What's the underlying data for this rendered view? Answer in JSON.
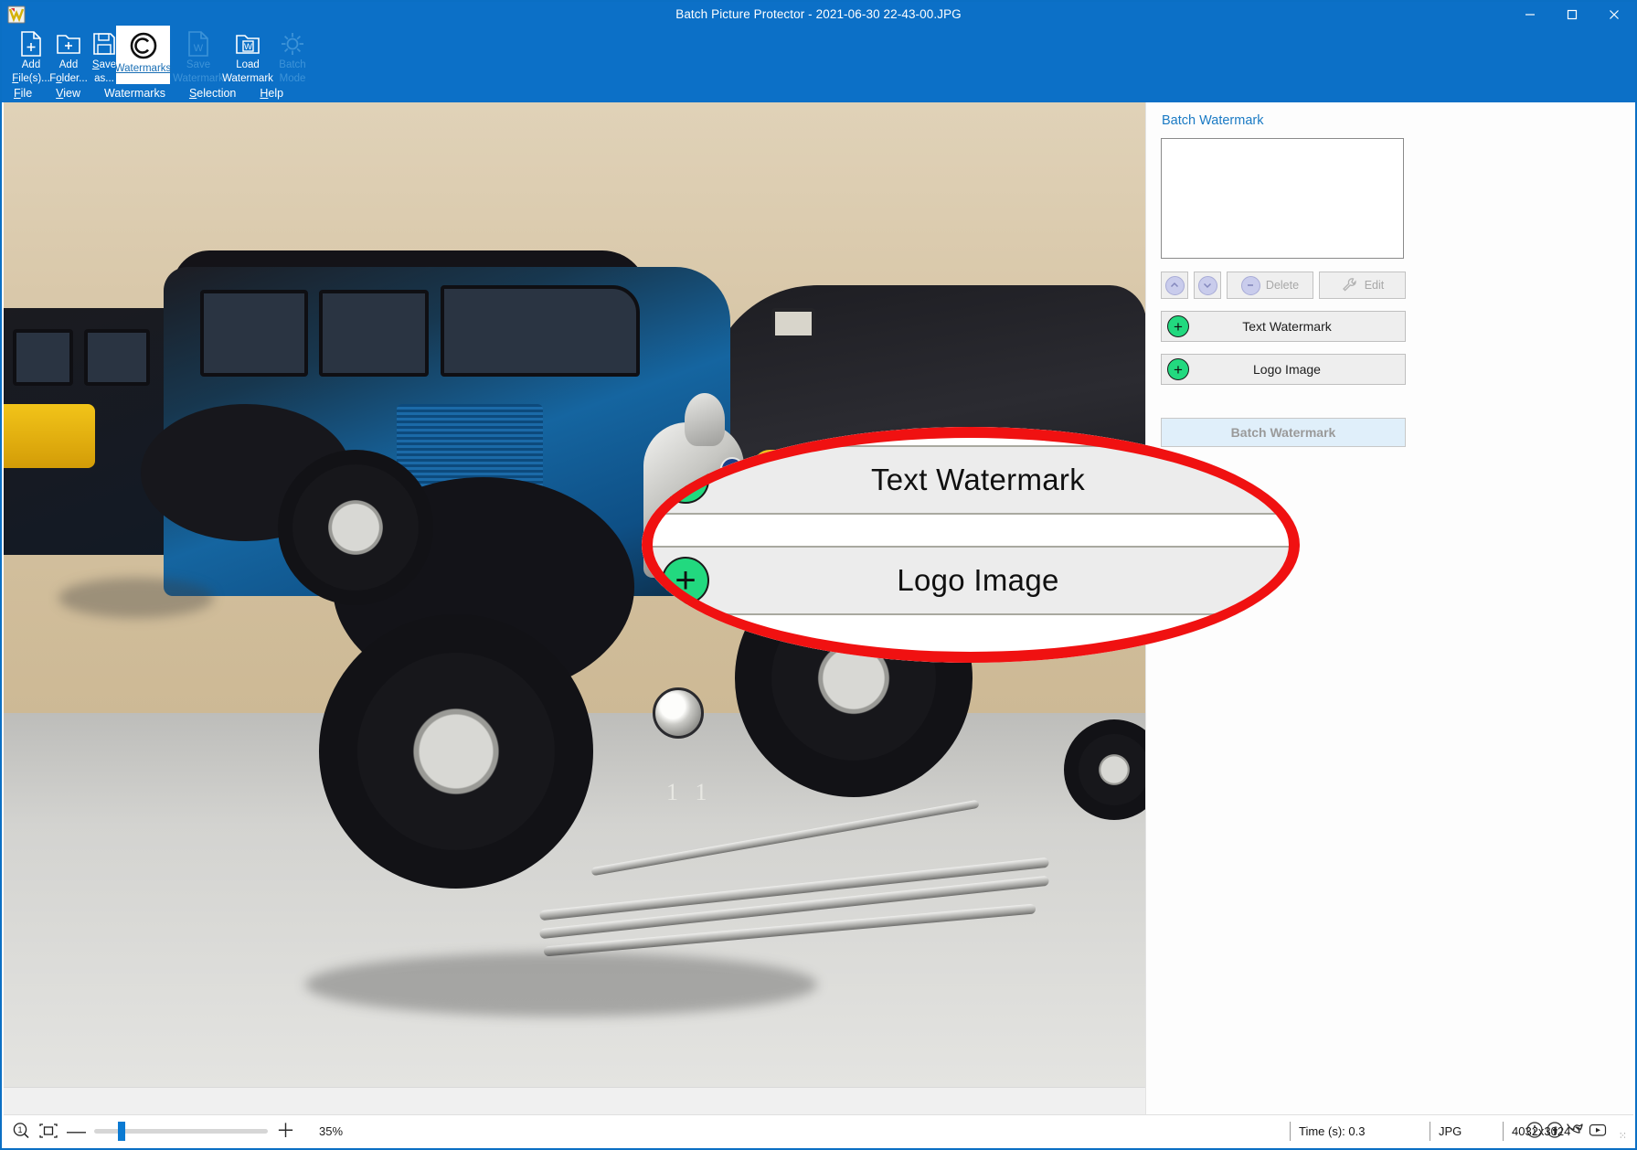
{
  "window": {
    "title": "Batch Picture Protector - 2021-06-30 22-43-00.JPG",
    "app_icon": "app-logo-icon",
    "minimize": "–",
    "maximize": "□",
    "close": "✕",
    "titlebar_color": "#0c70c7"
  },
  "ribbon": {
    "tools": [
      {
        "id": "add-files",
        "line1": "Add",
        "line2": "File(s)...",
        "icon": "file-add-icon",
        "state": "enabled"
      },
      {
        "id": "add-folder",
        "line1": "Add",
        "line2": "Folder...",
        "icon": "folder-add-icon",
        "state": "enabled"
      },
      {
        "id": "save-as",
        "line1": "Save",
        "line2": "as...",
        "icon": "floppy-save-icon",
        "state": "enabled"
      },
      {
        "id": "watermarks",
        "line1": "",
        "line2": "Watermarks",
        "icon": "copyright-icon",
        "state": "active"
      },
      {
        "id": "save-watermark",
        "line1": "Save",
        "line2": "Watermark",
        "icon": "doc-w-icon",
        "state": "disabled"
      },
      {
        "id": "load-watermark",
        "line1": "Load",
        "line2": "Watermark",
        "icon": "folder-w-icon",
        "state": "enabled"
      },
      {
        "id": "batch-mode",
        "line1": "Batch",
        "line2": "Mode",
        "icon": "gear-icon",
        "state": "disabled"
      }
    ]
  },
  "menubar": {
    "items": [
      {
        "id": "file",
        "label": "File"
      },
      {
        "id": "view",
        "label": "View"
      },
      {
        "id": "watermarks",
        "label": "Watermarks"
      },
      {
        "id": "selection",
        "label": "Selection"
      },
      {
        "id": "help",
        "label": "Help"
      }
    ]
  },
  "right_panel": {
    "title": "Batch Watermark",
    "list_items": [],
    "toolbar": {
      "move_up": "▲",
      "move_down": "▼",
      "delete_label": "Delete",
      "delete_icon": "minus-circle-icon",
      "edit_label": "Edit",
      "edit_icon": "wrench-icon"
    },
    "buttons": [
      {
        "id": "text-watermark",
        "label": "Text Watermark",
        "icon": "plus-circle-icon"
      },
      {
        "id": "logo-image",
        "label": "Logo Image",
        "icon": "plus-circle-icon"
      }
    ],
    "batch_button": {
      "id": "batch-watermark",
      "label": "Batch Watermark",
      "state": "disabled"
    },
    "accent_color": "#1a7ac4",
    "plus_color": "#22d97f"
  },
  "callout": {
    "highlight_color": "#f01111",
    "buttons": [
      {
        "id": "text-watermark-zoom",
        "label": "Text Watermark",
        "icon": "plus-circle-icon"
      },
      {
        "id": "logo-image-zoom",
        "label": "Logo Image",
        "icon": "plus-circle-icon"
      }
    ]
  },
  "statusbar": {
    "zoom_icon": "magnifier-1-icon",
    "fit_icon": "fit-to-window-icon",
    "minus": "—",
    "plus": "＋",
    "zoom_percent": "35%",
    "time_label": "Time (s): 0.3",
    "format": "JPG",
    "dimensions": "4032x3024",
    "social": [
      {
        "id": "info",
        "glyph": "ⓘ",
        "name": "info-icon"
      },
      {
        "id": "facebook",
        "glyph": "Ⓕ",
        "name": "facebook-icon"
      },
      {
        "id": "twitter",
        "glyph": "ᴠ",
        "name": "twitter-icon"
      },
      {
        "id": "youtube",
        "glyph": "▶",
        "name": "youtube-icon"
      }
    ],
    "grip": "⁙"
  },
  "preview": {
    "photo_description": "vintage blue automobile in museum"
  }
}
